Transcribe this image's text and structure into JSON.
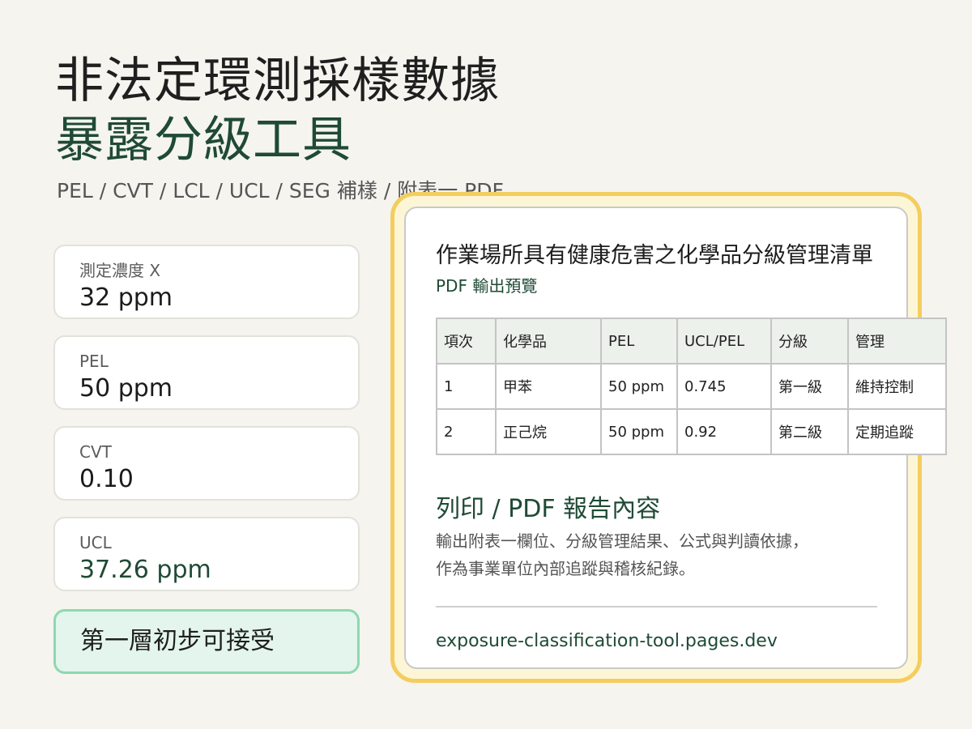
{
  "header": {
    "title_line1": "非法定環測採樣數據",
    "title_line2": "暴露分級工具",
    "subtitle": "PEL / CVT / LCL / UCL / SEG 補樣 / 附表一 PDF"
  },
  "metrics": [
    {
      "label": "測定濃度 X",
      "value": "32 ppm"
    },
    {
      "label": "PEL",
      "value": "50 ppm"
    },
    {
      "label": "CVT",
      "value": "0.10"
    },
    {
      "label": "UCL",
      "value": "37.26 ppm"
    }
  ],
  "result": {
    "text": "第一層初步可接受"
  },
  "preview": {
    "title": "作業場所具有健康危害之化學品分級管理清單",
    "subtitle": "PDF 輸出預覽",
    "table": {
      "headers": [
        "項次",
        "化學品",
        "PEL",
        "UCL/PEL",
        "分級",
        "管理"
      ],
      "rows": [
        [
          "1",
          "甲苯",
          "50 ppm",
          "0.745",
          "第一級",
          "維持控制"
        ],
        [
          "2",
          "正己烷",
          "50 ppm",
          "0.92",
          "第二級",
          "定期追蹤"
        ]
      ]
    },
    "section_heading": "列印 / PDF 報告內容",
    "description_line1": "輸出附表一欄位、分級管理結果、公式與判讀依據，",
    "description_line2": "作為事業單位內部追蹤與稽核紀錄。",
    "footer_url": "exposure-classification-tool.pages.dev"
  },
  "colors": {
    "background": "#f5f4ef",
    "accent_green": "#1f4a35",
    "result_fill": "#e3f5ec",
    "result_border": "#8fd8b0",
    "frame_yellow": "#f3cd5f"
  }
}
